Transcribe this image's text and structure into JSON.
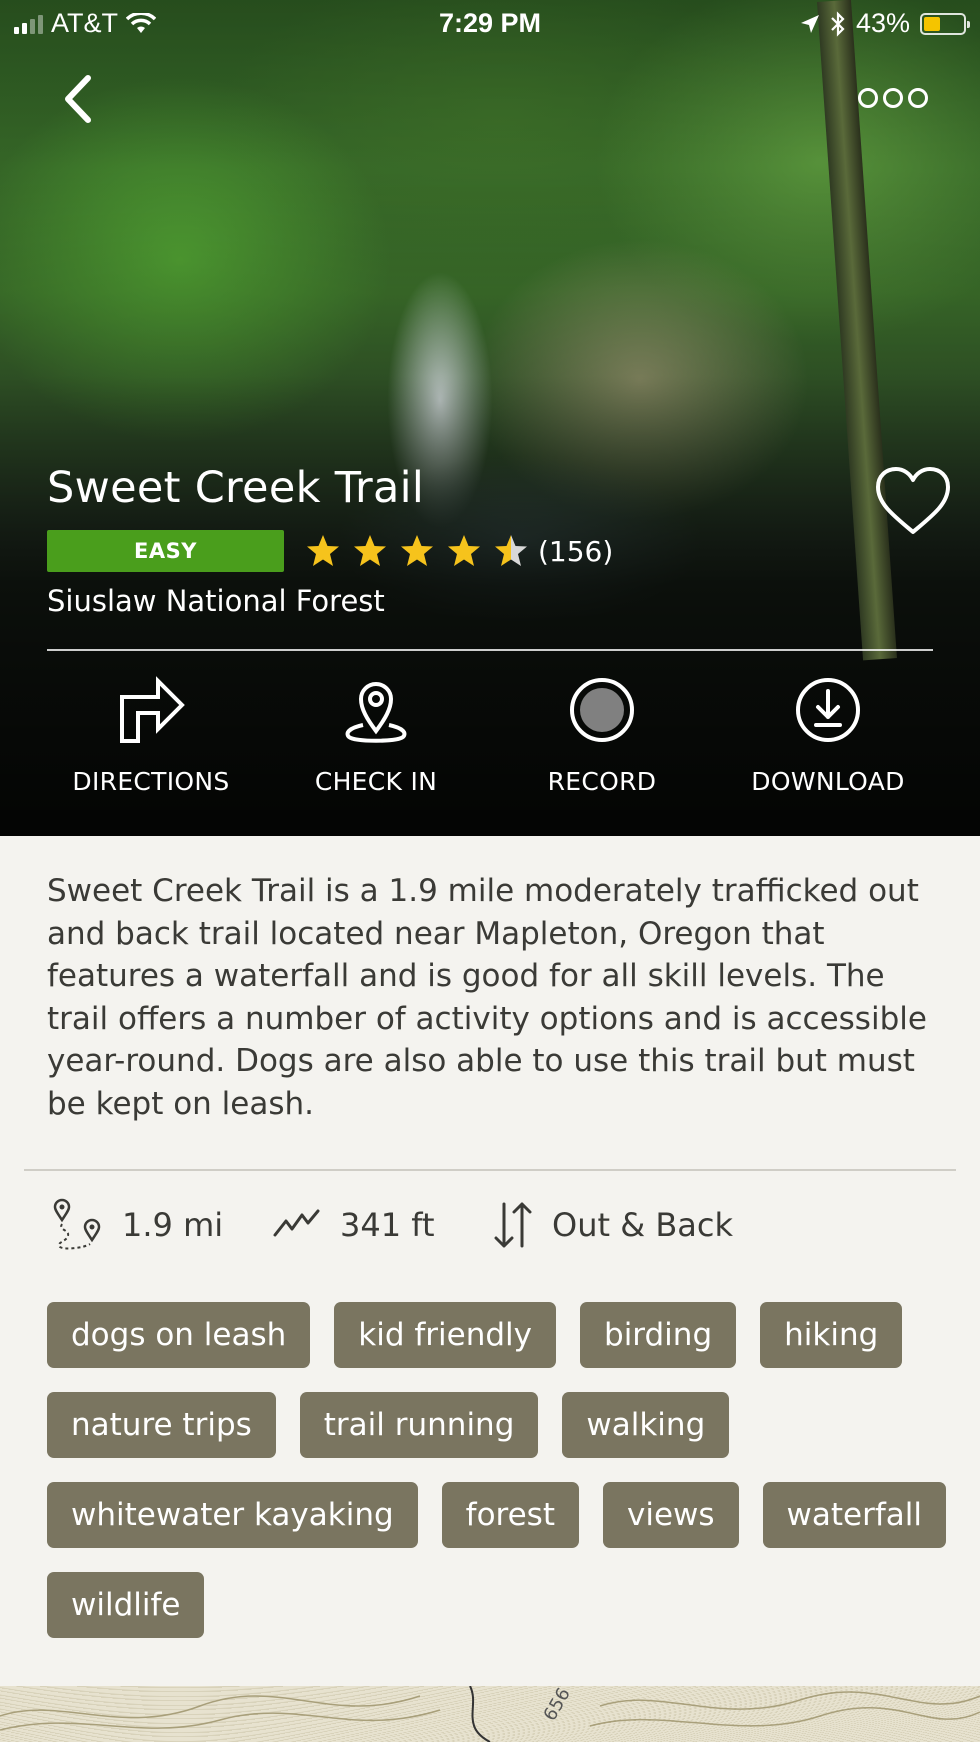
{
  "status_bar": {
    "carrier": "AT&T",
    "time": "7:29 PM",
    "battery": "43%",
    "battery_level": 0.43
  },
  "trail": {
    "name": "Sweet Creek Trail",
    "difficulty": "EASY",
    "rating": 4.5,
    "review_count": "(156)",
    "area": "Siuslaw National Forest"
  },
  "actions": [
    {
      "label": "DIRECTIONS",
      "icon": "directions-icon"
    },
    {
      "label": "CHECK IN",
      "icon": "map-pin-icon"
    },
    {
      "label": "RECORD",
      "icon": "record-icon"
    },
    {
      "label": "DOWNLOAD",
      "icon": "download-icon"
    }
  ],
  "description": "Sweet Creek Trail is a 1.9 mile moderately trafficked out and back trail located near Mapleton, Oregon that features a waterfall and is good for all skill levels. The trail offers a number of activity options and is accessible year-round. Dogs are also able to use this trail but must be kept on leash.",
  "stats": {
    "distance": "1.9 mi",
    "elevation": "341 ft",
    "route_type": "Out & Back"
  },
  "tags": [
    "dogs on leash",
    "kid friendly",
    "birding",
    "hiking",
    "nature trips",
    "trail running",
    "walking",
    "whitewater kayaking",
    "forest",
    "views",
    "waterfall",
    "wildlife"
  ],
  "map": {
    "contour_label": "656"
  },
  "colors": {
    "difficulty_badge": "#4a9e1c",
    "star": "#f6c31c",
    "tag_bg": "#7a7560",
    "background": "#f4f3ef"
  }
}
